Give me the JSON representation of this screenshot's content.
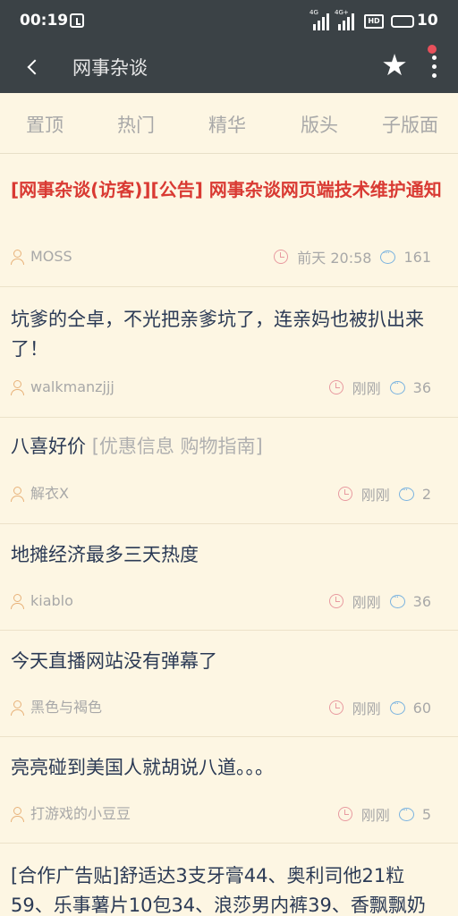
{
  "status_bar": {
    "time": "00:19",
    "net1": "4G",
    "net2": "4G+",
    "hd_label": "HD",
    "battery": "10"
  },
  "app_bar": {
    "title": "网事杂谈"
  },
  "tabs": [
    "置顶",
    "热门",
    "精华",
    "版头",
    "子版面"
  ],
  "posts": [
    {
      "title": "[网事杂谈(访客)][公告] 网事杂谈网页端技术维护通知",
      "tag": "",
      "author": "MOSS",
      "time": "前天  20:58",
      "replies": "161",
      "pinned": true
    },
    {
      "title": "坑爹的仝卓，不光把亲爹坑了，连亲妈也被扒出来了！",
      "tag": "",
      "author": "walkmanzjjj",
      "time": "刚刚",
      "replies": "36"
    },
    {
      "title": "八喜好价 ",
      "tag": "[优惠信息 购物指南]",
      "author": "解衣X",
      "time": "刚刚",
      "replies": "2"
    },
    {
      "title": "地摊经济最多三天热度",
      "tag": "",
      "author": "kiablo",
      "time": "刚刚",
      "replies": "36"
    },
    {
      "title": "今天直播网站没有弹幕了",
      "tag": "",
      "author": "黑色与褐色",
      "time": "刚刚",
      "replies": "60"
    },
    {
      "title": "亮亮碰到美国人就胡说八道。。。",
      "tag": "",
      "author": "打游戏的小豆豆",
      "time": "刚刚",
      "replies": "5"
    },
    {
      "title": "[合作广告贴]舒适达3支牙膏44、奥利司他21粒59、乐事薯片10包34、浪莎男内裤39、香飘飘奶",
      "tag": "",
      "author": "",
      "time": "",
      "replies": ""
    }
  ]
}
